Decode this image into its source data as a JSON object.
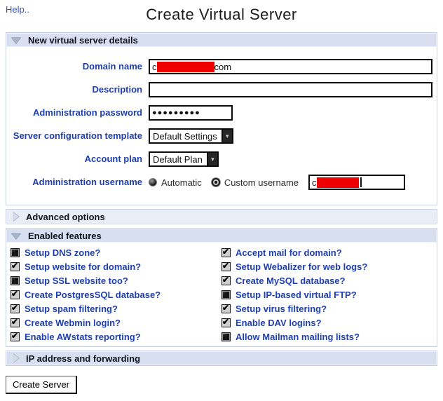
{
  "page": {
    "help_label": "Help..",
    "title": "Create Virtual Server"
  },
  "colors": {
    "accent_header": "#d7dff0",
    "label_blue": "#1f3fae",
    "redaction_red": "#ee0000"
  },
  "sections": {
    "details": {
      "title": "New virtual server details",
      "state_icon": "triangle-down-icon",
      "fields": {
        "domain": {
          "label": "Domain name",
          "value_prefix": "c",
          "value_suffix": "com",
          "redacted": true
        },
        "description": {
          "label": "Description",
          "value": ""
        },
        "password": {
          "label": "Administration password",
          "value": "●●●●●●●●●"
        },
        "template": {
          "label": "Server configuration template",
          "selected": "Default Settings"
        },
        "plan": {
          "label": "Account plan",
          "selected": "Default Plan"
        },
        "username": {
          "label": "Administration username",
          "options": [
            "Automatic",
            "Custom username"
          ],
          "selected_index": 1,
          "value_prefix": "c",
          "redacted": true
        }
      }
    },
    "advanced": {
      "title": "Advanced options",
      "state_icon": "triangle-right-icon"
    },
    "features": {
      "title": "Enabled features",
      "state_icon": "triangle-down-icon",
      "items": [
        {
          "label": "Setup DNS zone?",
          "checked": false
        },
        {
          "label": "Accept mail for domain?",
          "checked": true
        },
        {
          "label": "Setup website for domain?",
          "checked": true
        },
        {
          "label": "Setup Webalizer for web logs?",
          "checked": true
        },
        {
          "label": "Setup SSL website too?",
          "checked": false
        },
        {
          "label": "Create MySQL database?",
          "checked": true
        },
        {
          "label": "Create PostgresSQL database?",
          "checked": true
        },
        {
          "label": "Setup IP-based virtual FTP?",
          "checked": false
        },
        {
          "label": "Setup spam filtering?",
          "checked": true
        },
        {
          "label": "Setup virus filtering?",
          "checked": true
        },
        {
          "label": "Create Webmin login?",
          "checked": true
        },
        {
          "label": "Enable DAV logins?",
          "checked": true
        },
        {
          "label": "Enable AWstats reporting?",
          "checked": true
        },
        {
          "label": "Allow Mailman mailing lists?",
          "checked": false
        }
      ]
    },
    "ip": {
      "title": "IP address and forwarding",
      "state_icon": "triangle-right-icon"
    }
  },
  "footer": {
    "create_button": "Create Server"
  }
}
